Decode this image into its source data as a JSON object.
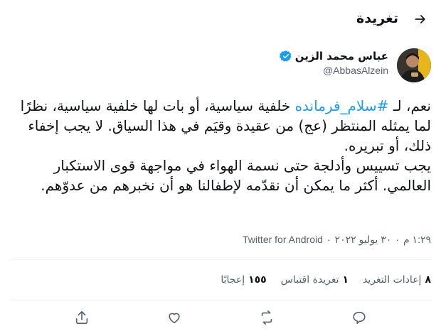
{
  "header": {
    "title": "تغريدة",
    "back_icon": "arrow-right-icon"
  },
  "author": {
    "name": "عباس محمد الزين",
    "handle": "@AbbasAlzein",
    "verified_icon": "verified-badge-icon",
    "verified_color": "#1d9bf0"
  },
  "tweet": {
    "line1_prefix": "نعم، لـ ",
    "hashtag": "#سلام_فرمانده",
    "line1_suffix": " خلفية سياسية، أو بات لها خلفية",
    "body_rest": "سياسية، نظرًا لما يمثله المنتظر (عج) من عقيدة وقيَم في هذا السياق. لا يجب إخفاء ذلك، أو تبريره.",
    "paragraph2": "يجب تسييس وأدلجة حتى نسمة الهواء في مواجهة قوى الاستكبار العالمي. أكثر ما يمكن أن نقدّمه لإطفالنا هو أن نخبرهم من عدوّهم."
  },
  "meta": {
    "time": "١:٢٩ م",
    "date": "٣٠ يوليو ٢٠٢٢",
    "separator": "·",
    "source": "Twitter for Android"
  },
  "stats": [
    {
      "count": "٨",
      "label": "إعادات التغريد"
    },
    {
      "count": "١",
      "label": "تغريدة اقتباس"
    },
    {
      "count": "١٥٥",
      "label": "إعجابًا"
    }
  ],
  "actions": [
    "reply-icon",
    "retweet-icon",
    "like-icon",
    "share-icon"
  ],
  "colors": {
    "accent": "#1d9bf0",
    "text": "#0f1419",
    "muted": "#536471",
    "divider": "#eff3f4"
  }
}
